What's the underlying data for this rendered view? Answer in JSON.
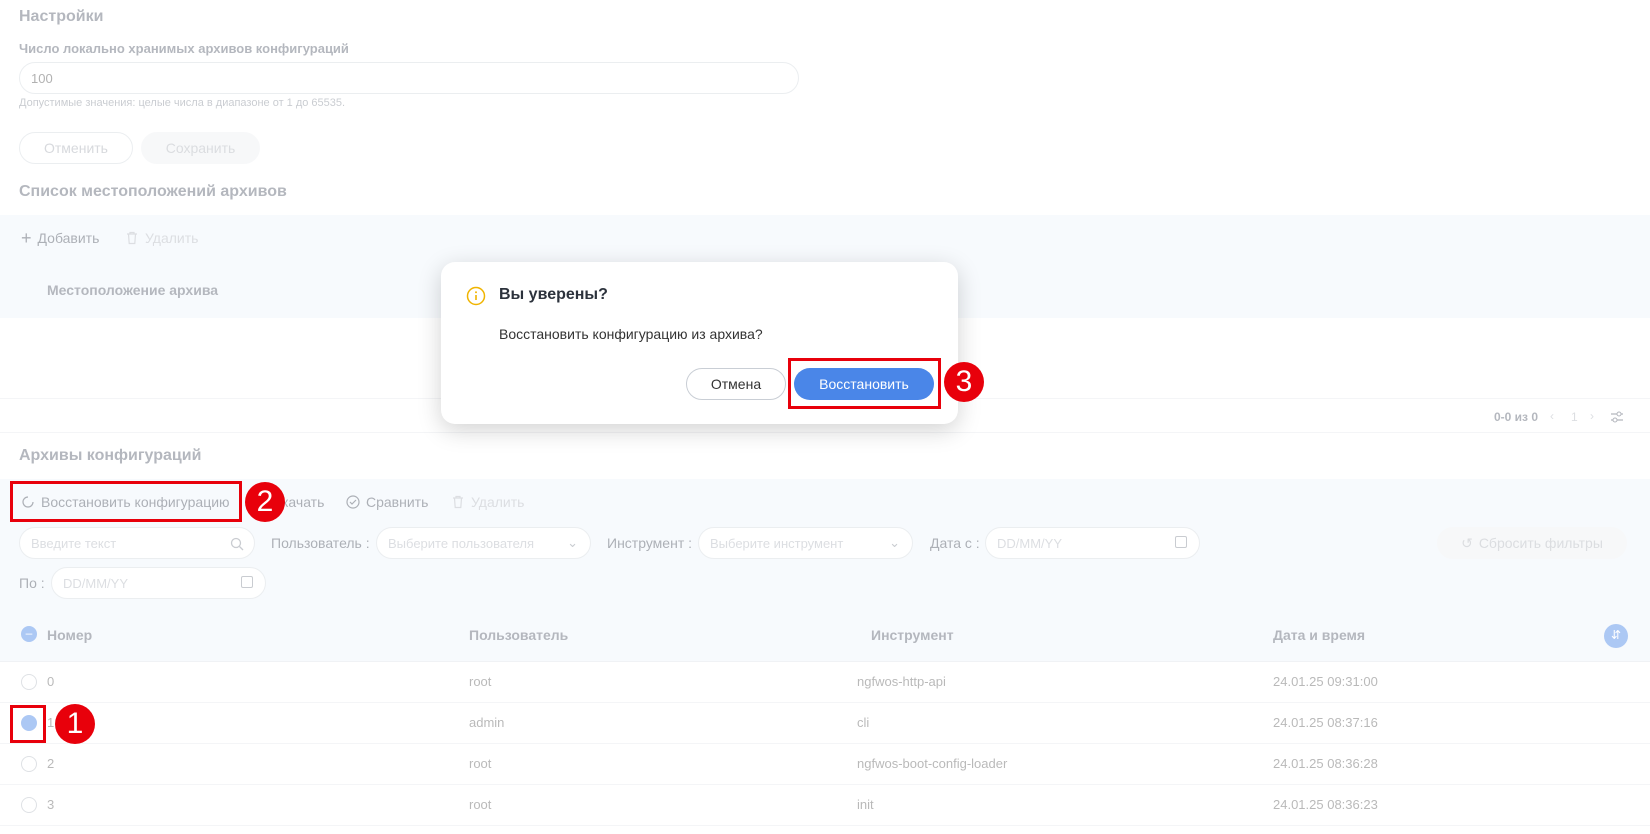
{
  "settings": {
    "title": "Настройки",
    "archives_count_label": "Число локально хранимых архивов конфигураций",
    "archives_count_value": "100",
    "hint": "Допустимые значения: целые числа в диапазоне от 1 до 65535.",
    "cancel_label": "Отменить",
    "save_label": "Сохранить"
  },
  "locations": {
    "title": "Список местоположений архивов",
    "add_label": "Добавить",
    "delete_label": "Удалить",
    "column": "Местоположение архива",
    "pager_text": "0-0 из 0",
    "page": "1"
  },
  "archives": {
    "title": "Архивы конфигураций",
    "restore_label": "Восстановить конфигурацию",
    "download_label": "качать",
    "compare_label": "Сравнить",
    "delete_label": "Удалить",
    "search_placeholder": "Введите текст",
    "user_label": "Пользователь :",
    "user_placeholder": "Выберите пользователя",
    "tool_label": "Инструмент :",
    "tool_placeholder": "Выберите инструмент",
    "date_from_label": "Дата с :",
    "date_placeholder": "DD/MM/YY",
    "date_to_label": "По :",
    "reset_label": "Сбросить фильтры",
    "columns": [
      "Номер",
      "Пользователь",
      "Инструмент",
      "Дата и время"
    ],
    "rows": [
      {
        "num": "0",
        "user": "root",
        "tool": "ngfwos-http-api",
        "date": "24.01.25 09:31:00",
        "checked": false
      },
      {
        "num": "1",
        "user": "admin",
        "tool": "cli",
        "date": "24.01.25 08:37:16",
        "checked": true
      },
      {
        "num": "2",
        "user": "root",
        "tool": "ngfwos-boot-config-loader",
        "date": "24.01.25 08:36:28",
        "checked": false
      },
      {
        "num": "3",
        "user": "root",
        "tool": "init",
        "date": "24.01.25 08:36:23",
        "checked": false
      }
    ]
  },
  "dialog": {
    "title": "Вы уверены?",
    "message": "Восстановить конфигурацию из архива?",
    "cancel_label": "Отмена",
    "confirm_label": "Восстановить"
  },
  "annotations": [
    "1",
    "2",
    "3"
  ],
  "colors": {
    "accent": "#4a86e8",
    "highlight": "#e8000b",
    "warning": "#f0b400"
  }
}
